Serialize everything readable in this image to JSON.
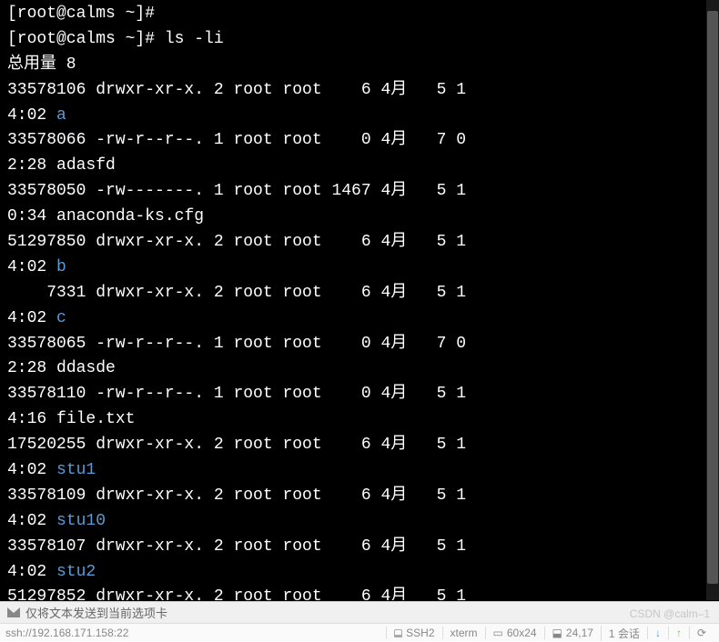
{
  "prompt1": "[root@calms ~]# ",
  "prompt2": "[root@calms ~]# ",
  "command": "ls -li",
  "total_label": "总用量 8",
  "entries": [
    {
      "inode": "33578106",
      "perms": "drwxr-xr-x.",
      "links": "2",
      "owner": "root",
      "group": "root",
      "size": "6",
      "month": "4月",
      "day": "5",
      "tp1": "1",
      "tp2": "4:02",
      "name": "a",
      "is_dir": true
    },
    {
      "inode": "33578066",
      "perms": "-rw-r--r--.",
      "links": "1",
      "owner": "root",
      "group": "root",
      "size": "0",
      "month": "4月",
      "day": "7",
      "tp1": "0",
      "tp2": "2:28",
      "name": "adasfd",
      "is_dir": false
    },
    {
      "inode": "33578050",
      "perms": "-rw-------.",
      "links": "1",
      "owner": "root",
      "group": "root",
      "size": "1467",
      "month": "4月",
      "day": "5",
      "tp1": "1",
      "tp2": "0:34",
      "name": "anaconda-ks.cfg",
      "is_dir": false
    },
    {
      "inode": "51297850",
      "perms": "drwxr-xr-x.",
      "links": "2",
      "owner": "root",
      "group": "root",
      "size": "6",
      "month": "4月",
      "day": "5",
      "tp1": "1",
      "tp2": "4:02",
      "name": "b",
      "is_dir": true
    },
    {
      "inode": "7331",
      "perms": "drwxr-xr-x.",
      "links": "2",
      "owner": "root",
      "group": "root",
      "size": "6",
      "month": "4月",
      "day": "5",
      "tp1": "1",
      "tp2": "4:02",
      "name": "c",
      "is_dir": true
    },
    {
      "inode": "33578065",
      "perms": "-rw-r--r--.",
      "links": "1",
      "owner": "root",
      "group": "root",
      "size": "0",
      "month": "4月",
      "day": "7",
      "tp1": "0",
      "tp2": "2:28",
      "name": "ddasde",
      "is_dir": false
    },
    {
      "inode": "33578110",
      "perms": "-rw-r--r--.",
      "links": "1",
      "owner": "root",
      "group": "root",
      "size": "0",
      "month": "4月",
      "day": "5",
      "tp1": "1",
      "tp2": "4:16",
      "name": "file.txt",
      "is_dir": false
    },
    {
      "inode": "17520255",
      "perms": "drwxr-xr-x.",
      "links": "2",
      "owner": "root",
      "group": "root",
      "size": "6",
      "month": "4月",
      "day": "5",
      "tp1": "1",
      "tp2": "4:02",
      "name": "stu1",
      "is_dir": true
    },
    {
      "inode": "33578109",
      "perms": "drwxr-xr-x.",
      "links": "2",
      "owner": "root",
      "group": "root",
      "size": "6",
      "month": "4月",
      "day": "5",
      "tp1": "1",
      "tp2": "4:02",
      "name": "stu10",
      "is_dir": true
    },
    {
      "inode": "33578107",
      "perms": "drwxr-xr-x.",
      "links": "2",
      "owner": "root",
      "group": "root",
      "size": "6",
      "month": "4月",
      "day": "5",
      "tp1": "1",
      "tp2": "4:02",
      "name": "stu2",
      "is_dir": true
    },
    {
      "inode": "51297852",
      "perms": "drwxr-xr-x.",
      "links": "2",
      "owner": "root",
      "group": "root",
      "size": "6",
      "month": "4月",
      "day": "5",
      "tp1": "1",
      "tp2": "",
      "name": "",
      "is_dir": true
    }
  ],
  "status_text": "仅将文本发送到当前选项卡",
  "watermark": "CSDN @calm–1",
  "bottom": {
    "host": "ssh://192.168.171.158:22",
    "ssh": "SSH2",
    "term": "xterm",
    "size": "60x24",
    "pos": "24,17",
    "session": "1 会话"
  }
}
